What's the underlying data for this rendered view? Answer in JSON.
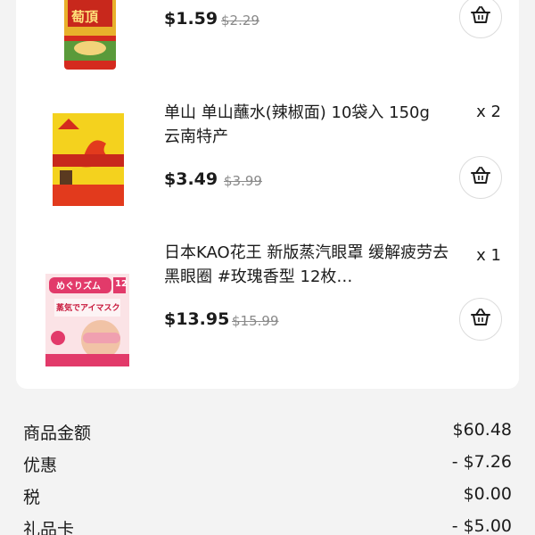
{
  "items": [
    {
      "title": "",
      "price": "$1.59",
      "original_price": "$2.29",
      "quantity": ""
    },
    {
      "title": "单山 单山蘸水(辣椒面) 10袋入 150g 云南特产",
      "price": "$3.49",
      "original_price": "$3.99",
      "quantity": "x 2"
    },
    {
      "title": "日本KAO花王 新版蒸汽眼罩 缓解疲劳去黑眼圈 #玫瑰香型 12枚…",
      "price": "$13.95",
      "original_price": "$15.99",
      "quantity": "x 1"
    }
  ],
  "product_art": {
    "can_label": "萄頂",
    "mask_brand": "めぐりズム",
    "mask_title": "蒸気でアイマスク",
    "mask_count": "12"
  },
  "summary": {
    "subtotal_label": "商品金额",
    "subtotal_value": "$60.48",
    "discount_label": "优惠",
    "discount_value": "- $7.26",
    "tax_label": "税",
    "tax_value": "$0.00",
    "giftcard_label": "礼品卡",
    "giftcard_value": "- $5.00"
  },
  "icons": {
    "cart": "shopping-basket-icon"
  },
  "colors": {
    "background": "#f3f3f3",
    "card": "#ffffff",
    "text": "#1b1b1b",
    "strikethrough": "#8a8a8a",
    "button_border": "#dcdcdc"
  }
}
